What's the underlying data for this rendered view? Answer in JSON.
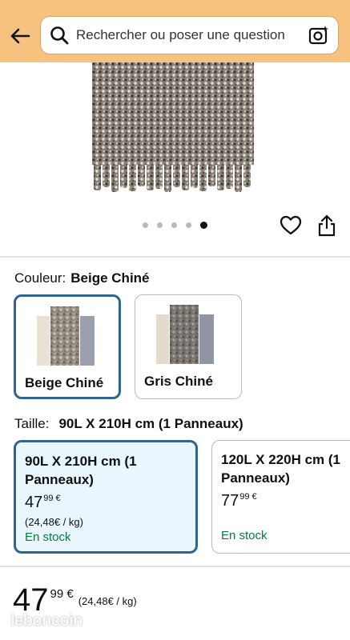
{
  "search": {
    "placeholder": "Rechercher ou poser une question"
  },
  "gallery": {
    "image_count": 5,
    "active_index": 4
  },
  "color": {
    "label": "Couleur:",
    "selected": "Beige Chiné",
    "options": [
      {
        "name": "Beige Chiné",
        "selected": true
      },
      {
        "name": "Gris Chiné",
        "selected": false
      }
    ]
  },
  "size": {
    "label": "Taille:",
    "selected": "90L X 210H cm (1 Panneaux)",
    "options": [
      {
        "title": "90L X 210H cm (1 Panneaux)",
        "price_whole": "47",
        "price_fraction": "99 €",
        "unit_price": "(24,48€ / kg)",
        "availability": "En stock",
        "selected": true
      },
      {
        "title": "120L X 220H cm (1 Panneaux)",
        "price_whole": "77",
        "price_fraction": "99 €",
        "unit_price": "",
        "availability": "En stock",
        "selected": false
      }
    ]
  },
  "price": {
    "whole": "47",
    "fraction": "99 €",
    "unit_price": "(24,48€ / kg)"
  },
  "watermark": "leboncoin",
  "colors": {
    "header": "#f7c27f",
    "selected_border": "#2f6690",
    "in_stock": "#067d3e"
  }
}
